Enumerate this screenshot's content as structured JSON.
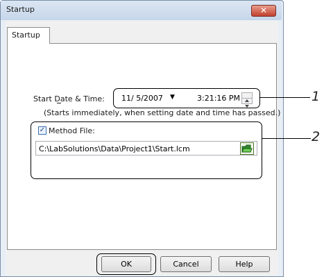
{
  "window": {
    "title": "Startup",
    "close_glyph": "✕"
  },
  "tabs": [
    {
      "label": "Startup"
    }
  ],
  "start": {
    "label": "Start Date & Time:",
    "date_value": "11/ 5/2007",
    "dropdown_glyph": "▼",
    "time_value": "3:21:16 PM",
    "note": "(Starts immediately, when setting date and time has passed.)"
  },
  "method": {
    "checkbox_checked": true,
    "check_glyph": "✓",
    "label": "Method File:",
    "path": "C:\\LabSolutions\\Data\\Project1\\Start.lcm",
    "browse_icon": "folder-open-icon"
  },
  "buttons": {
    "ok": "OK",
    "cancel": "Cancel",
    "help": "Help"
  },
  "callouts": {
    "one": "1",
    "two": "2"
  }
}
